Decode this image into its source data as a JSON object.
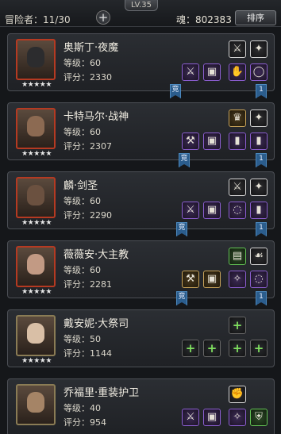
{
  "header": {
    "level": "LV.35",
    "roster_label": "冒险者：",
    "roster_count": "11/30",
    "add_symbol": "+",
    "soul_label": "魂：",
    "soul_value": "802383",
    "sort_label": "排序"
  },
  "labels": {
    "level_prefix": "等级：",
    "score_prefix": "评分：",
    "arena_badge": "竞",
    "rank_badge": "1"
  },
  "heroes": [
    {
      "name": "奥斯丁·夜魔",
      "level": "60",
      "score": "2330",
      "stars": "★★★★★"
    },
    {
      "name": "卡特马尔·战神",
      "level": "60",
      "score": "2307",
      "stars": "★★★★★"
    },
    {
      "name": "麟·剑圣",
      "level": "60",
      "score": "2290",
      "stars": "★★★★★"
    },
    {
      "name": "薇薇安·大主教",
      "level": "60",
      "score": "2281",
      "stars": "★★★★★"
    },
    {
      "name": "戴安妮·大祭司",
      "level": "50",
      "score": "1144",
      "stars": "★★★★★"
    },
    {
      "name": "乔福里·重装护卫",
      "level": "40",
      "score": "954",
      "stars": ""
    }
  ]
}
